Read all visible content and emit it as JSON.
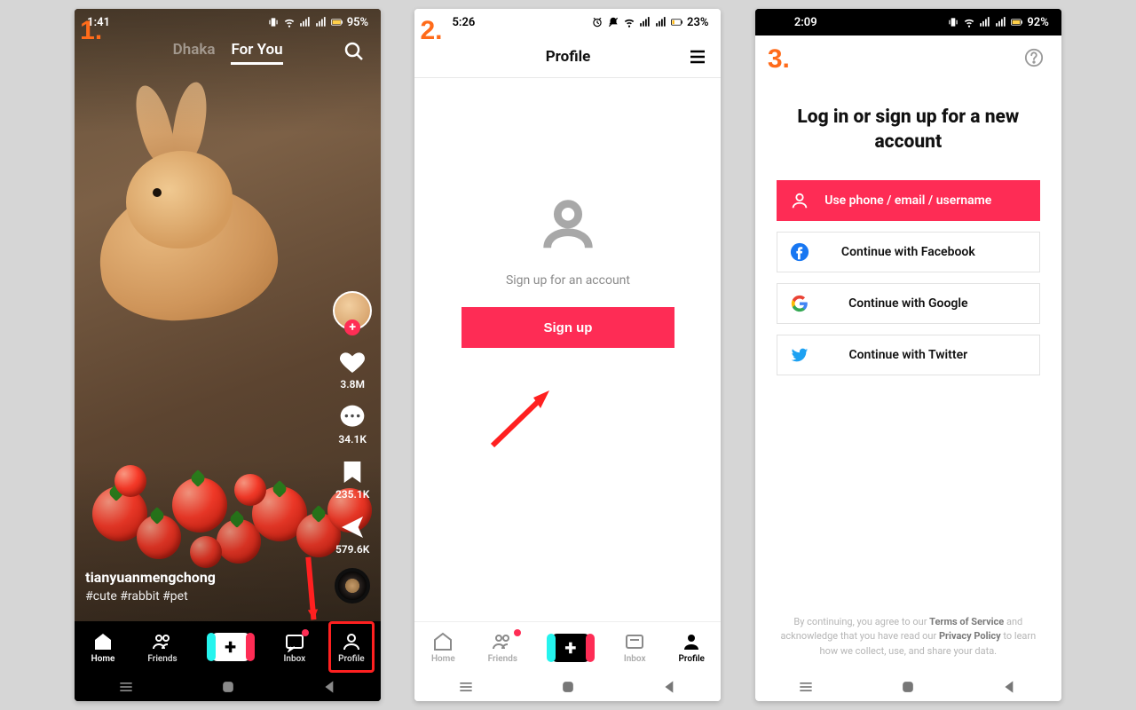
{
  "screen1": {
    "step": "1.",
    "status_time": "1:41",
    "status_battery": "95%",
    "tab_inactive": "Dhaka",
    "tab_active": "For You",
    "likes": "3.8M",
    "comments": "34.1K",
    "bookmarks": "235.1K",
    "shares": "579.6K",
    "username": "tianyuanmengchong",
    "hashtags": "#cute #rabbit #pet",
    "nav": {
      "home": "Home",
      "friends": "Friends",
      "inbox": "Inbox",
      "profile": "Profile"
    }
  },
  "screen2": {
    "step": "2.",
    "status_time": "5:26",
    "status_battery": "23%",
    "header_title": "Profile",
    "prompt": "Sign up for an account",
    "button": "Sign up",
    "nav": {
      "home": "Home",
      "friends": "Friends",
      "inbox": "Inbox",
      "profile": "Profile"
    }
  },
  "screen3": {
    "step": "3.",
    "status_time": "2:09",
    "status_battery": "92%",
    "title": "Log in or sign up for a new account",
    "opt_phone": "Use phone / email / username",
    "opt_fb": "Continue with Facebook",
    "opt_google": "Continue with Google",
    "opt_twitter": "Continue with Twitter",
    "disclaimer_1": "By continuing, you agree to our ",
    "disclaimer_tos": "Terms of Service",
    "disclaimer_2": " and acknowledge that you have read our ",
    "disclaimer_pp": "Privacy Policy",
    "disclaimer_3": " to learn how we collect, use, and share your data."
  }
}
